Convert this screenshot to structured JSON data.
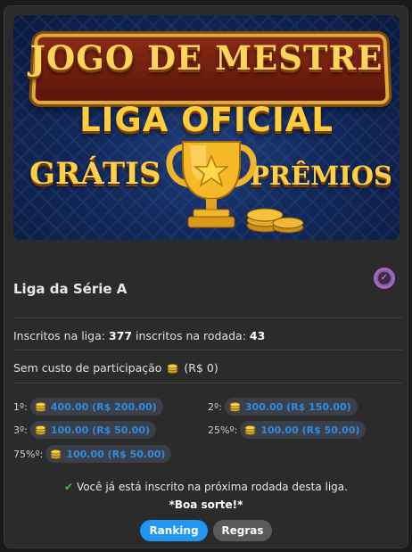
{
  "banner": {
    "line1": "JOGO DE MESTRE",
    "line2": "LIGA OFICIAL",
    "left_word": "GRÁTIS",
    "right_word": "PRÊMIOS"
  },
  "league": {
    "title": "Liga da Série A",
    "badge_icon": "check-badge-icon",
    "enrolled_label": "Inscritos na liga:",
    "enrolled_league": "377",
    "enrolled_round_label": "inscritos na rodada:",
    "enrolled_round": "43",
    "cost_label": "Sem custo de participação",
    "cost_value": "(R$ 0)"
  },
  "prizes": [
    {
      "place": "1º:",
      "amount": "400.00 (R$ 200.00)"
    },
    {
      "place": "2º:",
      "amount": "300.00 (R$ 150.00)"
    },
    {
      "place": "3º:",
      "amount": "100.00 (R$ 50.00)"
    },
    {
      "place": "25%º:",
      "amount": "100.00 (R$ 50.00)"
    },
    {
      "place": "75%º:",
      "amount": "100.00 (R$ 50.00)"
    }
  ],
  "status": {
    "confirm": "Você já está inscrito na próxima rodada desta liga.",
    "luck": "*Boa sorte!*"
  },
  "buttons": {
    "ranking": "Ranking",
    "rules": "Regras"
  },
  "colors": {
    "accent": "#2196f3",
    "pill_text": "#2f8ce0",
    "gold": "#ffcc3a",
    "success": "#3ec23e"
  }
}
